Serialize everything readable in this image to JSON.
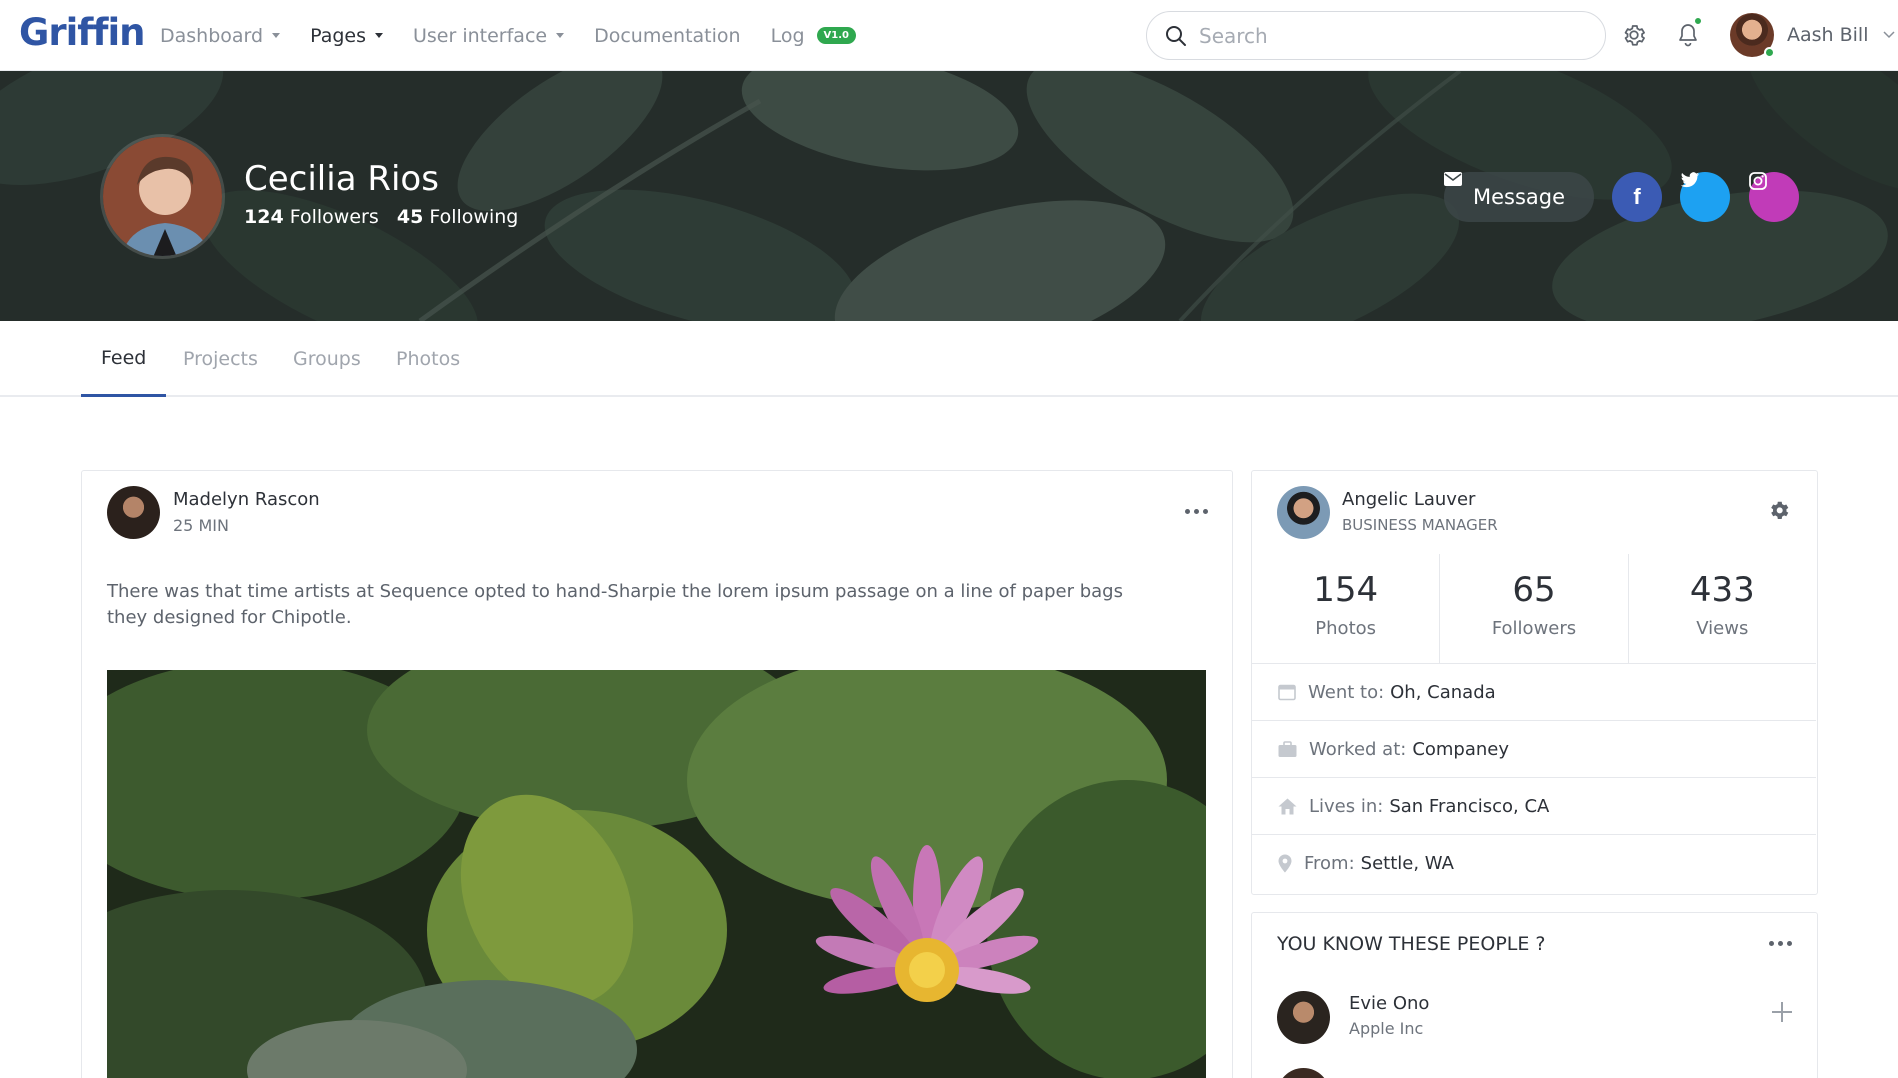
{
  "brand": {
    "name": "Griffin",
    "color": "#2f55a4"
  },
  "nav": {
    "items": [
      {
        "label": "Dashboard",
        "has_caret": true,
        "active": false
      },
      {
        "label": "Pages",
        "has_caret": true,
        "active": true
      },
      {
        "label": "User interface",
        "has_caret": true,
        "active": false
      },
      {
        "label": "Documentation",
        "has_caret": false,
        "active": false
      },
      {
        "label": "Log",
        "has_caret": false,
        "active": false
      }
    ],
    "log_badge": "V1.0"
  },
  "search": {
    "placeholder": "Search",
    "value": ""
  },
  "user": {
    "name": "Aash Bill",
    "online": true
  },
  "notifications": {
    "has_new": true
  },
  "profile": {
    "name": "Cecilia Rios",
    "followers_count": "124",
    "followers_label": "Followers",
    "following_count": "45",
    "following_label": "Following",
    "message_button": "Message",
    "social": {
      "facebook": "f",
      "twitter": "twitter",
      "instagram": "instagram"
    }
  },
  "tabs": [
    {
      "label": "Feed",
      "active": true
    },
    {
      "label": "Projects",
      "active": false
    },
    {
      "label": "Groups",
      "active": false
    },
    {
      "label": "Photos",
      "active": false
    }
  ],
  "post": {
    "author": "Madelyn Rascon",
    "time": "25 MIN",
    "text": "There was that time artists at Sequence opted to hand-Sharpie the lorem ipsum passage on a line of paper bags they designed for Chipotle."
  },
  "side_profile": {
    "name": "Angelic Lauver",
    "role": "BUSINESS MANAGER",
    "stats": [
      {
        "value": "154",
        "label": "Photos"
      },
      {
        "value": "65",
        "label": "Followers"
      },
      {
        "value": "433",
        "label": "Views"
      }
    ],
    "info": [
      {
        "icon": "calendar-icon",
        "label": "Went to:",
        "value": "Oh, Canada"
      },
      {
        "icon": "briefcase-icon",
        "label": "Worked at:",
        "value": "Companey"
      },
      {
        "icon": "home-icon",
        "label": "Lives in:",
        "value": "San Francisco, CA"
      },
      {
        "icon": "map-pin-icon",
        "label": "From:",
        "value": "Settle, WA"
      }
    ]
  },
  "people": {
    "title": "YOU KNOW THESE PEOPLE ?",
    "list": [
      {
        "name": "Evie Ono",
        "company": "Apple Inc"
      }
    ]
  },
  "colors": {
    "accent": "#2f55a4",
    "online": "#2fa84f",
    "facebook": "#3b5bb4",
    "twitter": "#1da1f2",
    "instagram": "#c13bb8"
  }
}
